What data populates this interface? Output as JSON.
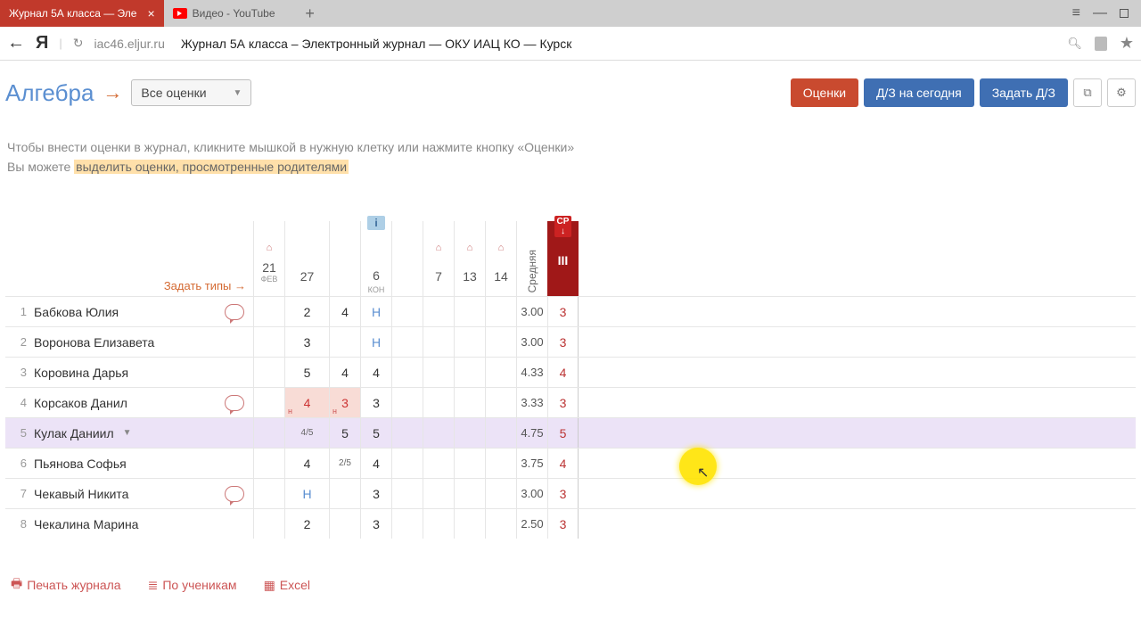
{
  "browser": {
    "tabs": [
      {
        "title": "Журнал 5А класса — Эле",
        "active": true
      },
      {
        "title": "Видео - YouTube",
        "active": false
      }
    ],
    "url_host": "iac46.eljur.ru",
    "url_title": "Журнал 5А класса – Электронный журнал — ОКУ ИАЦ КО — Курск"
  },
  "header": {
    "subject": "Алгебра",
    "filter": "Все оценки",
    "btn_grades": "Оценки",
    "btn_hw": "Д/З на сегодня",
    "btn_assign": "Задать Д/З"
  },
  "hint": {
    "line1": "Чтобы внести оценки в журнал, кликните мышкой в нужную клетку или нажмите кнопку «Оценки»",
    "line2_a": "Вы можете ",
    "line2_b": "выделить оценки, просмотренные родителями"
  },
  "table": {
    "set_types": "Задать типы →",
    "avg_label": "Средняя",
    "period_label": "III",
    "cp_label": "СР ↓",
    "dates": [
      {
        "day": "21",
        "month": "ФЕВ",
        "home": true,
        "type": ""
      },
      {
        "day": "27",
        "month": "",
        "home": false,
        "type": "",
        "w50": true
      },
      {
        "day": "",
        "month": "",
        "home": false,
        "type": ""
      },
      {
        "day": "6",
        "month": "",
        "home": false,
        "type": "КОН",
        "info": true
      },
      {
        "day": "",
        "month": "",
        "home": false,
        "type": ""
      },
      {
        "day": "7",
        "month": "",
        "home": true,
        "type": ""
      },
      {
        "day": "13",
        "month": "",
        "home": true,
        "type": ""
      },
      {
        "day": "14",
        "month": "",
        "home": true,
        "type": ""
      }
    ],
    "students": [
      {
        "idx": "1",
        "name": "Бабкова Юлия",
        "comment": true,
        "grades": [
          "",
          "2",
          "4",
          "Н",
          "",
          "",
          "",
          ""
        ],
        "avg": "3.00",
        "per": "3"
      },
      {
        "idx": "2",
        "name": "Воронова Елизавета",
        "comment": false,
        "grades": [
          "",
          "3",
          "",
          "Н",
          "",
          "",
          "",
          ""
        ],
        "avg": "3.00",
        "per": "3"
      },
      {
        "idx": "3",
        "name": "Коровина Дарья",
        "comment": false,
        "grades": [
          "",
          "5",
          "4",
          "4",
          "",
          "",
          "",
          ""
        ],
        "avg": "4.33",
        "per": "4"
      },
      {
        "idx": "4",
        "name": "Корсаков Данил",
        "comment": true,
        "grades": [
          "",
          "4ⁿ",
          "3ⁿ",
          "3",
          "",
          "",
          "",
          ""
        ],
        "avg": "3.33",
        "per": "3"
      },
      {
        "idx": "5",
        "name": "Кулак Даниил",
        "comment": false,
        "selected": true,
        "caret": true,
        "grades": [
          "",
          "4/5",
          "5",
          "5",
          "",
          "",
          "",
          ""
        ],
        "avg": "4.75",
        "per": "5"
      },
      {
        "idx": "6",
        "name": "Пьянова Софья",
        "comment": false,
        "grades": [
          "",
          "4",
          "2/5",
          "4",
          "",
          "",
          "",
          ""
        ],
        "avg": "3.75",
        "per": "4"
      },
      {
        "idx": "7",
        "name": "Чекавый Никита",
        "comment": true,
        "grades": [
          "",
          "Н",
          "",
          "3",
          "",
          "",
          "",
          ""
        ],
        "avg": "3.00",
        "per": "3"
      },
      {
        "idx": "8",
        "name": "Чекалина Марина",
        "comment": false,
        "grades": [
          "",
          "2",
          "",
          "3",
          "",
          "",
          "",
          ""
        ],
        "avg": "2.50",
        "per": "3"
      }
    ]
  },
  "footer": {
    "print": "Печать журнала",
    "by_students": "По ученикам",
    "excel": "Excel"
  }
}
